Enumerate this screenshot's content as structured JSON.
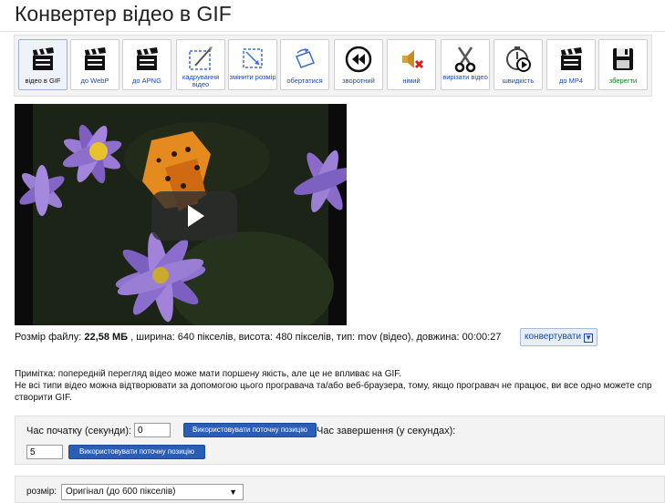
{
  "page": {
    "title": "Конвертер відео в GIF"
  },
  "toolbar": {
    "items": [
      {
        "label": "відео в GIF",
        "icon": "clapperboard-gif-icon"
      },
      {
        "label": "до WebP",
        "icon": "clapperboard-webp-icon"
      },
      {
        "label": "до APNG",
        "icon": "clapperboard-apng-icon"
      },
      {
        "label": "кадрування відео",
        "icon": "crop-icon"
      },
      {
        "label": "змінити розмір",
        "icon": "resize-icon"
      },
      {
        "label": "обертатися",
        "icon": "rotate-icon"
      },
      {
        "label": "зворотний",
        "icon": "rewind-icon"
      },
      {
        "label": "німий",
        "icon": "mute-icon"
      },
      {
        "label": "вирізати відео",
        "icon": "scissors-icon"
      },
      {
        "label": "швидкість",
        "icon": "speed-icon"
      },
      {
        "label": "до MP4",
        "icon": "clapperboard-mp4-icon"
      },
      {
        "label": "зберегти",
        "icon": "save-disk-icon"
      }
    ]
  },
  "file_info": {
    "size_prefix": "Розмір файлу: ",
    "size_value": "22,58 МБ",
    "details": " , ширина: 640 пікселів, висота: 480 пікселів, тип: mov (відео), довжина: 00:00:27",
    "convert_label": "конвертувати"
  },
  "note": {
    "line1": "Примітка: попередній перегляд відео може мати поршену якість, але це не впливає на GIF.",
    "line2": "Не всі типи відео можна відтворювати за допомогою цього програвача та/або веб-браузера, тому, якщо програвач не працює, ви все одно можете спр",
    "line3": "створити GIF."
  },
  "time": {
    "start_label": "Час початку (секунди):",
    "start_value": "0",
    "use_current_label": "Використовувати поточну позицію",
    "end_label": "Час завершення (у секундах):",
    "end_value": "5",
    "use_current_label_2": "Використовувати поточну позицію"
  },
  "size": {
    "label": "розмір:",
    "selected": "Оригінал (до 600 пікселів)"
  },
  "colors": {
    "accent": "#2a5db5",
    "link": "#1a48b0",
    "panel": "#f3f3f3"
  }
}
